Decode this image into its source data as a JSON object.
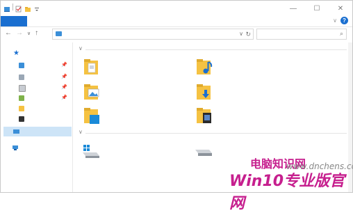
{
  "titlebar": {
    "minimize": "—",
    "maximize": "☐",
    "close": "✕"
  },
  "ribbon": {
    "collapse_glyph": "∨",
    "help_glyph": "?"
  },
  "nav": {
    "back": "←",
    "forward": "→",
    "recent": "∨",
    "up": "↑"
  },
  "address": {
    "dropdown_glyph": "∨",
    "refresh_glyph": "↻"
  },
  "search": {
    "icon": "⌕"
  },
  "groups": [
    {
      "chevron": "∨"
    },
    {
      "chevron": "∨"
    }
  ],
  "watermark": {
    "line1": "电脑知识网",
    "url": "www.dnchens.com",
    "line2": "Win10专业版官网"
  },
  "colors": {
    "accent": "#1a6fd0",
    "folder": "#f5c242",
    "selection": "#cde4f7",
    "watermark": "#c61f8e"
  },
  "icons": {
    "quick_access": "star-icon",
    "folders": [
      "desktop-folder-icon",
      "music-folder-icon",
      "pictures-folder-icon",
      "downloads-folder-icon",
      "documents-folder-icon",
      "videos-folder-icon"
    ],
    "drives": [
      "windows-drive-icon",
      "hard-drive-icon"
    ]
  }
}
